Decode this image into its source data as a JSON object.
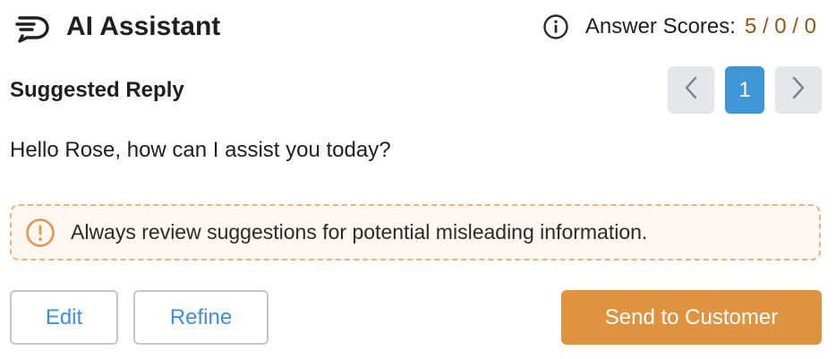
{
  "header": {
    "logo_icon": "chat-bubble-logo-icon",
    "title": "AI Assistant",
    "info_icon": "info-icon",
    "scores_label": "Answer Scores:",
    "scores_value": "5 / 0 / 0"
  },
  "suggested_reply": {
    "title": "Suggested Reply",
    "pager": {
      "prev_icon": "chevron-left-icon",
      "current_page": "1",
      "next_icon": "chevron-right-icon"
    },
    "text": "Hello Rose, how can I assist you today?"
  },
  "warning": {
    "icon": "warning-icon",
    "text": "Always review suggestions for potential misleading information."
  },
  "actions": {
    "edit_label": "Edit",
    "refine_label": "Refine",
    "send_label": "Send to Customer"
  },
  "colors": {
    "accent_blue": "#3e96d6",
    "link_blue": "#3d8ee0",
    "send_orange": "#e0933e",
    "warning_border": "#efb278",
    "scores_value": "#8a5a14"
  }
}
